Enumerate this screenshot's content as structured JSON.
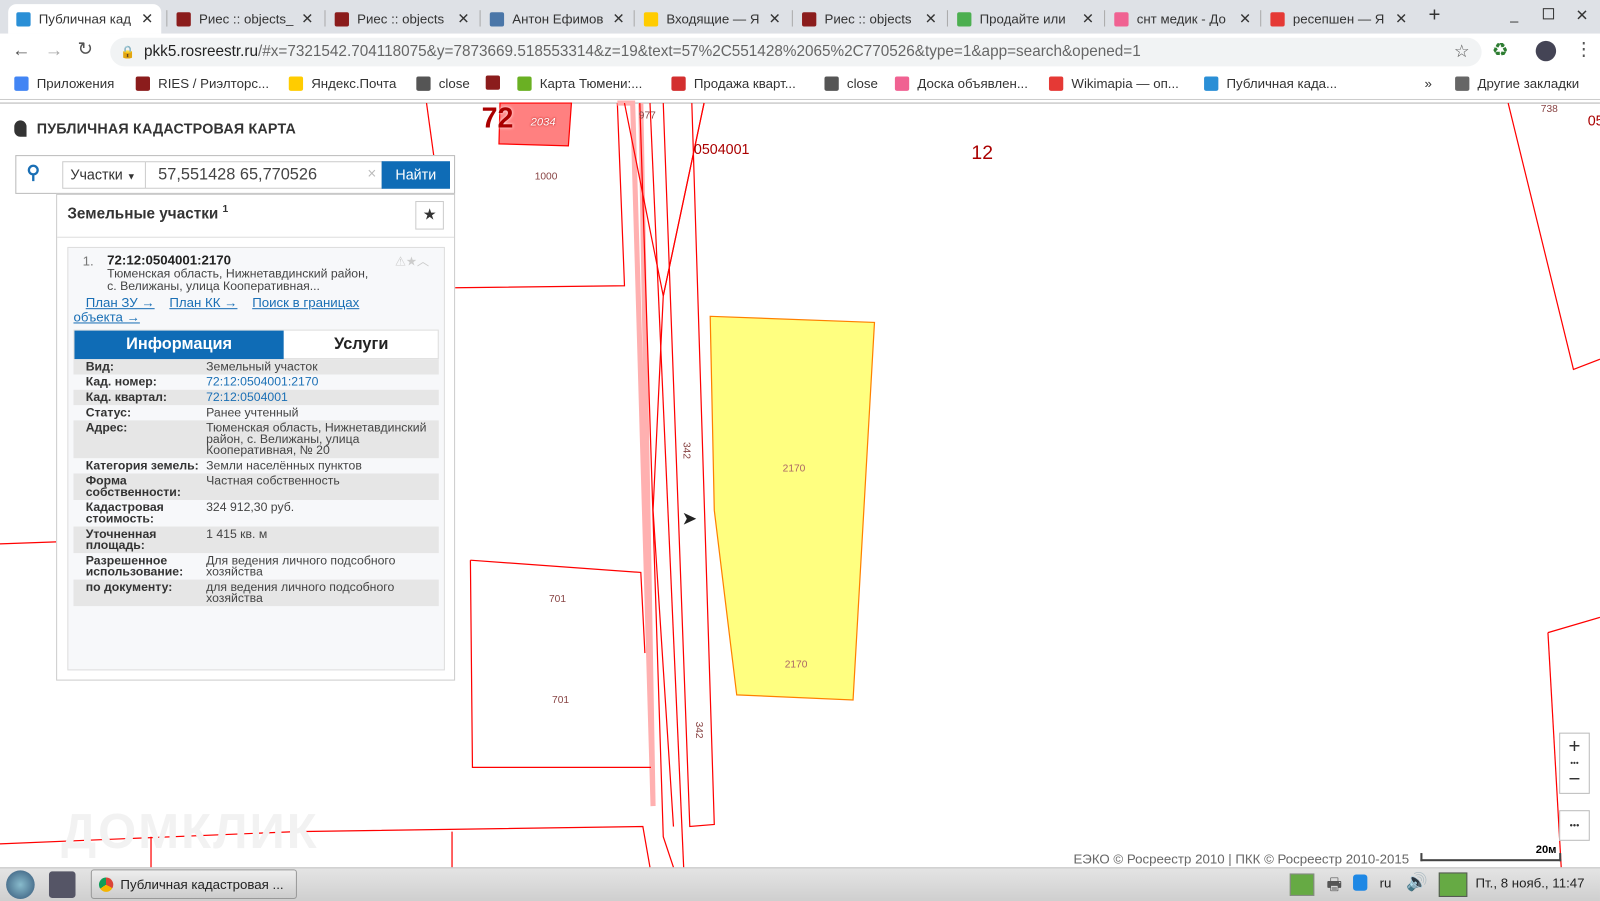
{
  "browser": {
    "tabs": [
      {
        "title": "Публичная кад",
        "active": true,
        "icon_color": "#2a8fd6"
      },
      {
        "title": "Риес :: objects_",
        "icon_color": "#8b1c1c"
      },
      {
        "title": "Риес :: objects",
        "icon_color": "#8b1c1c"
      },
      {
        "title": "Антон Ефимов",
        "icon_color": "#4a76a8"
      },
      {
        "title": "Входящие — Я",
        "icon_color": "#ffcc00"
      },
      {
        "title": "Риес :: objects",
        "icon_color": "#8b1c1c"
      },
      {
        "title": "Продайте или",
        "icon_color": "#4caf50"
      },
      {
        "title": "снт медик - До",
        "icon_color": "#f06292"
      },
      {
        "title": "ресепшен — Я",
        "icon_color": "#e53935"
      }
    ],
    "new_tab": "+",
    "url_host": "pkk5.rosreestr.ru",
    "url_rest": "/#x=7321542.704118075&y=7873669.518553314&z=19&text=57%2C551428%2065%2C770526&type=1&app=search&opened=1",
    "bookmarks": [
      {
        "label": "Приложения",
        "icon_color": "#4285f4"
      },
      {
        "label": "RIES / Риэлторс...",
        "icon_color": "#8b1c1c"
      },
      {
        "label": "Яндекс.Почта",
        "icon_color": "#ffcc00"
      },
      {
        "label": "close",
        "icon_color": "#555555"
      },
      {
        "label": "",
        "icon_color": "#8b1c1c"
      },
      {
        "label": "Карта Тюмени:...",
        "icon_color": "#6ab023"
      },
      {
        "label": "Продажа кварт...",
        "icon_color": "#d32f2f"
      },
      {
        "label": "close",
        "icon_color": "#555555"
      },
      {
        "label": "Доска объявлен...",
        "icon_color": "#f06292"
      },
      {
        "label": "Wikimapia — оп...",
        "icon_color": "#e53935"
      },
      {
        "label": "Публичная када...",
        "icon_color": "#2a8fd6"
      }
    ],
    "bookmarks_more": "»",
    "other_bookmarks": "Другие закладки"
  },
  "app": {
    "title": "ПУБЛИЧНАЯ КАДАСТРОВАЯ КАРТА",
    "search": {
      "type": "Участки",
      "value": "57,551428 65,770526",
      "clear": "×",
      "button": "Найти"
    },
    "results_title": "Земельные участки",
    "results_count": "1",
    "result": {
      "index": "1.",
      "cad_number": "72:12:0504001:2170",
      "address_short": "Тюменская область, Нижнетавдинский район, с. Велижаны, улица Кооперативная...",
      "links": [
        "План ЗУ →",
        "План КК →",
        "Поиск в границах объекта →"
      ],
      "tabs": [
        "Информация",
        "Услуги"
      ],
      "info": [
        {
          "key": "Вид:",
          "value": "Земельный участок"
        },
        {
          "key": "Кад. номер:",
          "value": "72:12:0504001:2170",
          "link": true
        },
        {
          "key": "Кад. квартал:",
          "value": "72:12:0504001",
          "link": true
        },
        {
          "key": "Статус:",
          "value": "Ранее учтенный"
        },
        {
          "key": "Адрес:",
          "value": "Тюменская область, Нижнетавдинский район, с. Велижаны, улица Кооперативная, № 20"
        },
        {
          "key": "Категория земель:",
          "value": "Земли населённых пунктов"
        },
        {
          "key": "Форма собственности:",
          "value": "Частная собственность"
        },
        {
          "key": "Кадастровая стоимость:",
          "value": "324 912,30 руб."
        },
        {
          "key": "Уточненная площадь:",
          "value": "1 415 кв. м"
        },
        {
          "key": "Разрешенное использование:",
          "value": "Для ведения личного подсобного хозяйства"
        },
        {
          "key": "по документу:",
          "value": "для ведения личного подсобного хозяйства"
        }
      ]
    },
    "map_labels": {
      "region": "72",
      "parcel_2034": "2034",
      "p977": "977",
      "quarter": "0504001",
      "district": "12",
      "p1000": "1000",
      "p342a": "342",
      "p342b": "342",
      "p2170a": "2170",
      "p2170b": "2170",
      "p701a": "701",
      "p701b": "701",
      "p738": "738",
      "edge": "05"
    },
    "zoom_in": "+",
    "zoom_out": "−",
    "more": "•••",
    "copyright": "ЕЭКО © Росреестр 2010 | ПКК © Росреестр 2010-2015",
    "scale": "20м",
    "watermark": "ДОМКЛИК"
  },
  "taskbar": {
    "window_title": "Публичная кадастровая ...",
    "lang": "ru",
    "clock": "Пт., 8 нояб., 11:47"
  }
}
